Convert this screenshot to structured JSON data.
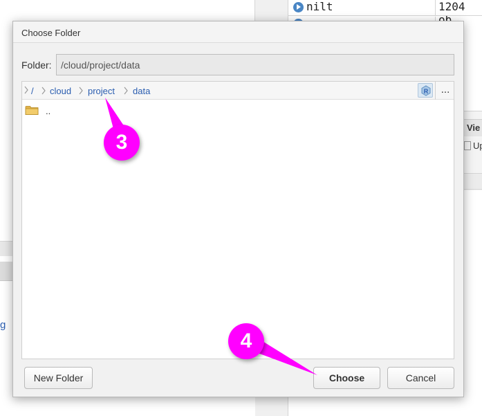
{
  "background": {
    "environment_rows": [
      {
        "name": "nilt",
        "value": "1204 ob"
      },
      {
        "name": "",
        "value": "ob"
      }
    ],
    "right_panel_tab": "Vie",
    "right_panel_checkbox_label": "Up",
    "left_link_fragment": "g"
  },
  "dialog": {
    "title": "Choose Folder",
    "folder_label": "Folder:",
    "folder_value": "/cloud/project/data",
    "breadcrumbs": [
      "/",
      "cloud",
      "project",
      "data"
    ],
    "more_label": "...",
    "files": [
      {
        "name": "..",
        "icon": "folder-icon"
      }
    ],
    "buttons": {
      "new_folder": "New Folder",
      "choose": "Choose",
      "cancel": "Cancel"
    }
  },
  "annotations": {
    "callout_3": "3",
    "callout_4": "4",
    "color": "#ff00ff"
  }
}
